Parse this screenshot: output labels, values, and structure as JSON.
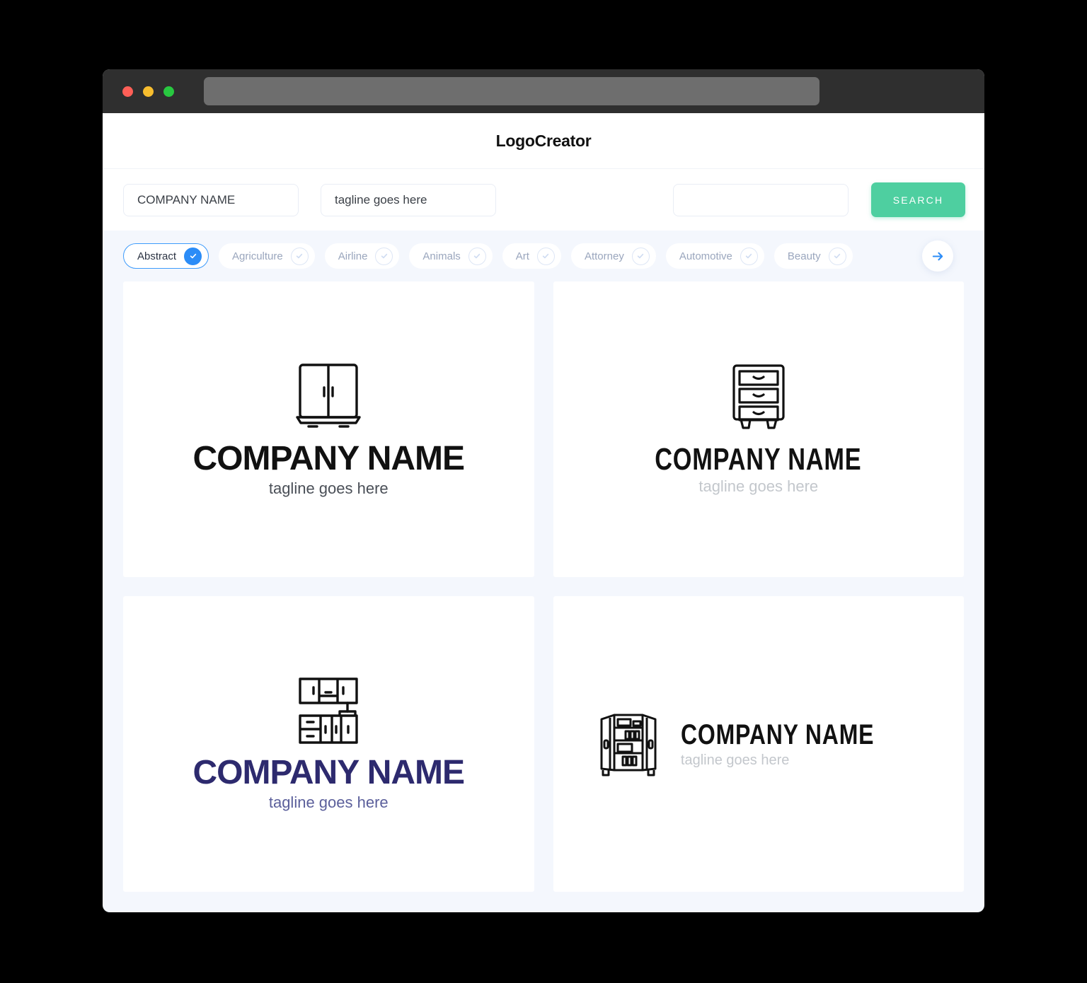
{
  "window": {
    "traffic_lights": [
      "close",
      "minimize",
      "maximize"
    ],
    "url_value": ""
  },
  "header": {
    "brand": "LogoCreator"
  },
  "search": {
    "company_value": "COMPANY NAME",
    "company_placeholder": "COMPANY NAME",
    "tagline_value": "tagline goes here",
    "tagline_placeholder": "tagline goes here",
    "extra_value": "",
    "extra_placeholder": "",
    "search_label": "SEARCH",
    "accent_color": "#4ecfa0"
  },
  "categories": {
    "selected": "Abstract",
    "accent_color": "#2b8cf7",
    "items": [
      {
        "label": "Abstract",
        "selected": true
      },
      {
        "label": "Agriculture",
        "selected": false
      },
      {
        "label": "Airline",
        "selected": false
      },
      {
        "label": "Animals",
        "selected": false
      },
      {
        "label": "Art",
        "selected": false
      },
      {
        "label": "Attorney",
        "selected": false
      },
      {
        "label": "Automotive",
        "selected": false
      },
      {
        "label": "Beauty",
        "selected": false
      }
    ],
    "next_icon": "arrow-right-icon"
  },
  "results": [
    {
      "mark": "wardrobe-cabinet-icon",
      "name": "COMPANY NAME",
      "tagline": "tagline goes here",
      "name_color": "#111111",
      "tagline_color": "#4a4f57",
      "layout": "stacked"
    },
    {
      "mark": "drawer-dresser-icon",
      "name": "COMPANY NAME",
      "tagline": "tagline goes here",
      "name_color": "#111111",
      "tagline_color": "#c3c7cc",
      "layout": "stacked"
    },
    {
      "mark": "kitchen-cabinets-icon",
      "name": "COMPANY NAME",
      "tagline": "tagline goes here",
      "name_color": "#2d2a6e",
      "tagline_color": "#5b5f9b",
      "layout": "stacked"
    },
    {
      "mark": "open-wardrobe-icon",
      "name": "COMPANY NAME",
      "tagline": "tagline goes here",
      "name_color": "#111111",
      "tagline_color": "#c3c7cc",
      "layout": "horizontal"
    }
  ]
}
